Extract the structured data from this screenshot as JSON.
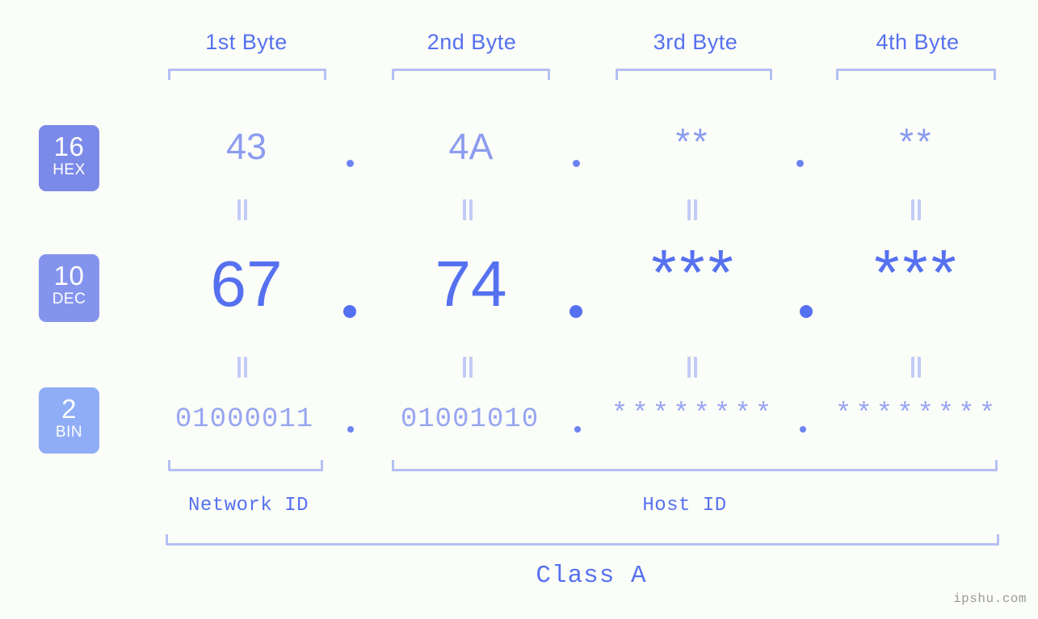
{
  "columns": [
    {
      "label": "1st Byte"
    },
    {
      "label": "2nd Byte"
    },
    {
      "label": "3rd Byte"
    },
    {
      "label": "4th Byte"
    }
  ],
  "rows": {
    "hex": {
      "badge_num": "16",
      "badge_name": "HEX",
      "values": [
        "43",
        "4A",
        "**",
        "**"
      ],
      "separator": "."
    },
    "dec": {
      "badge_num": "10",
      "badge_name": "DEC",
      "values": [
        "67",
        "74",
        "***",
        "***"
      ],
      "separator": "."
    },
    "bin": {
      "badge_num": "2",
      "badge_name": "BIN",
      "values": [
        "01000011",
        "01001010",
        "********",
        "********"
      ],
      "separator": "."
    }
  },
  "connectors": {
    "symbol": "||"
  },
  "footer": {
    "network_id": "Network ID",
    "host_id": "Host ID",
    "class_label": "Class A",
    "watermark": "ipshu.com"
  },
  "colors": {
    "background": "#fbfdf8",
    "accent": "#5671f0",
    "accent_light": "#8c9cf0",
    "bracket": "#b4bff5",
    "badge_hex": "#7b8ae8",
    "badge_dec": "#8494ed",
    "badge_bin": "#8fadf7",
    "watermark": "#9a9a9a"
  }
}
